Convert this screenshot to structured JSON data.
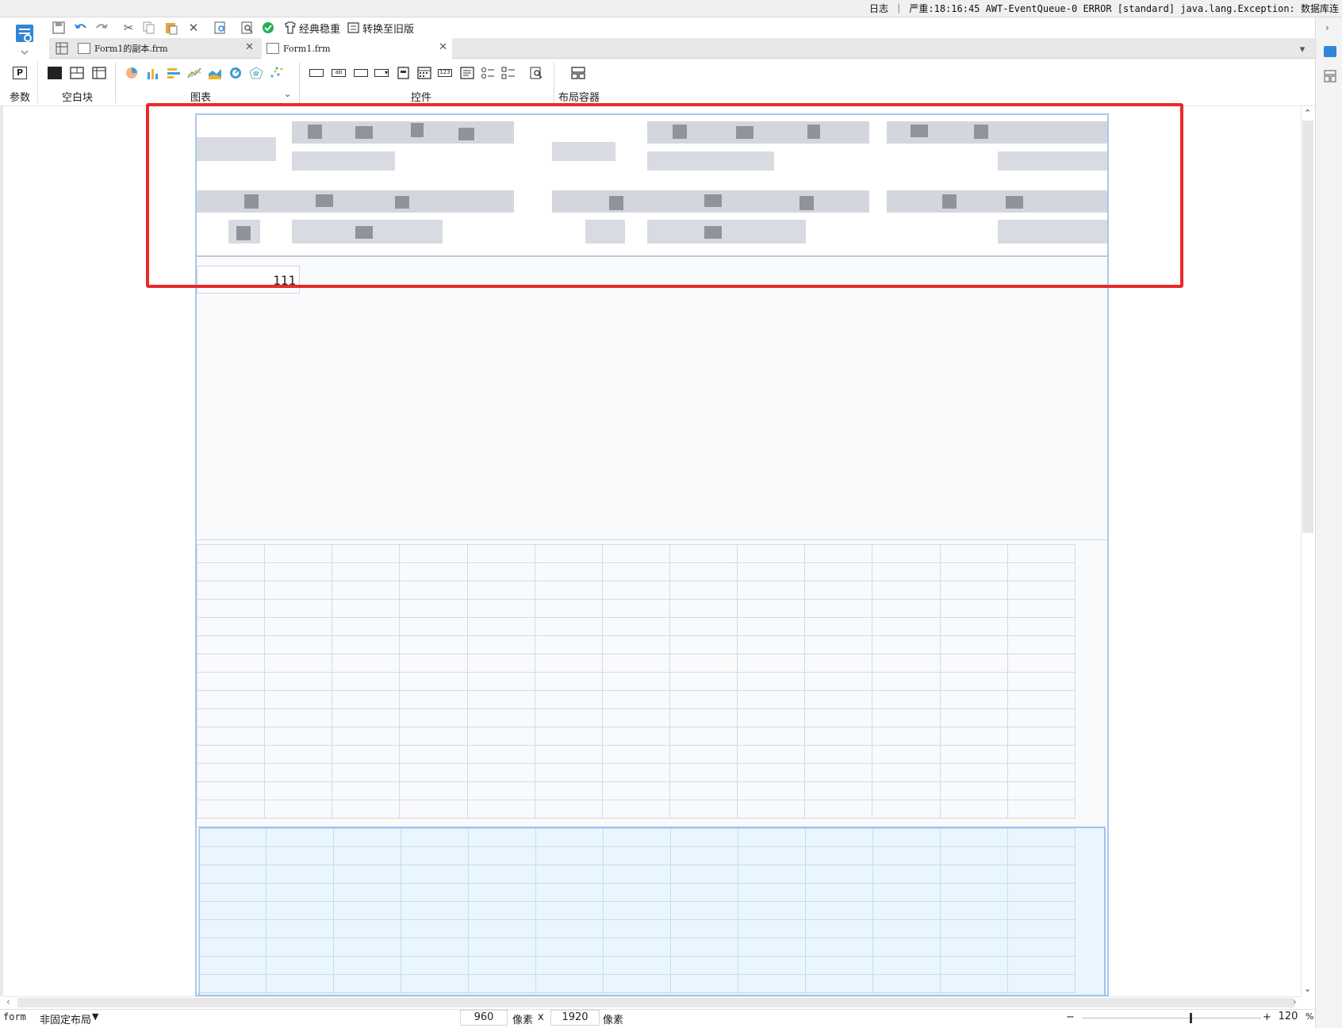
{
  "log_bar": {
    "text": "日志 ｜ 严重:18:16:45 AWT-EventQueue-0 ERROR [standard] java.lang.Exception: 数据库连"
  },
  "quick_toolbar": {
    "classic_theme_label": "经典稳重",
    "convert_old_label": "转换至旧版"
  },
  "tabs": [
    {
      "label": "Form1的副本.frm",
      "active": false
    },
    {
      "label": "Form1.frm",
      "active": true
    }
  ],
  "ribbon": {
    "groups": [
      {
        "label": "参数"
      },
      {
        "label": "空白块"
      },
      {
        "label": "图表"
      },
      {
        "label": "控件"
      },
      {
        "label": "布局容器"
      }
    ]
  },
  "canvas": {
    "cell_value": "111"
  },
  "status_bar": {
    "form_name": "form",
    "layout_mode": "非固定布局",
    "width_value": "960",
    "width_unit": "像素",
    "times": "x",
    "height_value": "1920",
    "height_unit": "像素",
    "zoom_minus": "−",
    "zoom_plus": "+",
    "zoom_value": "120",
    "zoom_unit": "%",
    "zoom_level": 0.6
  },
  "colors": {
    "highlight_border": "#e82a2a",
    "selection_fill": "#e9f6fd",
    "page_border": "#a9c8ee",
    "app_blue": "#2f86d6"
  },
  "icons": {
    "app": "document-menu-icon",
    "save": "save-icon",
    "undo": "undo-icon",
    "redo": "redo-icon",
    "cut": "cut-icon",
    "copy": "copy-icon",
    "paste": "paste-icon",
    "delete": "delete-icon",
    "preview": "preview-icon",
    "check": "check-circle-icon"
  }
}
